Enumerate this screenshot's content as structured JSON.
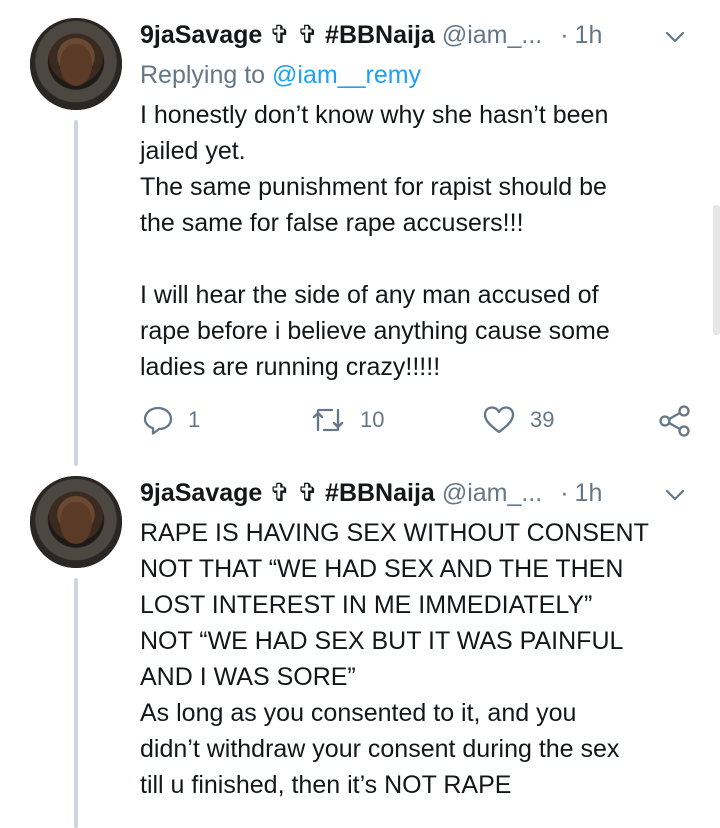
{
  "tweets": [
    {
      "name": "9jaSavage ✞ ✞ #BBNaija",
      "handle": "@iam_...",
      "separator": "·",
      "time": "1h",
      "replying_label": "Replying to ",
      "replying_handle": "@iam__remy",
      "text": "I honestly don’t know why she hasn’t been\njailed yet.\nThe same punishment for rapist should be\nthe same for false rape accusers!!!\n\nI will hear the side of any man accused of\nrape before i believe anything cause some\nladies are running crazy!!!!!",
      "replies": "1",
      "retweets": "10",
      "likes": "39"
    },
    {
      "name": "9jaSavage ✞ ✞ #BBNaija",
      "handle": "@iam_...",
      "separator": "·",
      "time": "1h",
      "text": "RAPE IS HAVING SEX WITHOUT CONSENT\nNOT THAT “WE HAD SEX AND THE THEN\nLOST INTEREST IN ME IMMEDIATELY”\nNOT “WE HAD SEX BUT IT WAS PAINFUL\nAND I WAS SORE”\nAs long as you consented to it, and you\ndidn’t withdraw your consent during the sex\ntill u finished, then it’s NOT RAPE"
    }
  ],
  "icons": {
    "avatar": "profile-photo",
    "reply": "speech-bubble-icon",
    "retweet": "retweet-arrows-icon",
    "like": "heart-outline-icon",
    "share": "share-nodes-icon",
    "more": "chevron-down-icon"
  },
  "colors": {
    "link": "#1da1f2",
    "muted": "#657786",
    "text": "#14171a",
    "thread_line": "#ccd6dd"
  }
}
